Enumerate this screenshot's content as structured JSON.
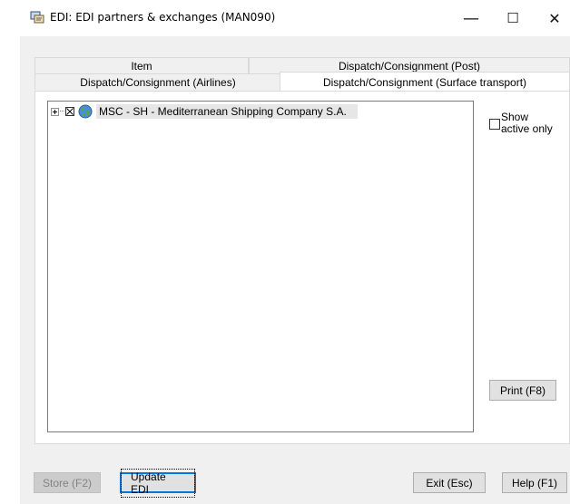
{
  "window": {
    "title": "EDI: EDI partners & exchanges (MAN090)",
    "icon": "edi-app-icon",
    "controls": {
      "minimize": "—",
      "maximize": "☐",
      "close": "✕"
    }
  },
  "tabs": {
    "row1": [
      {
        "label": "Item"
      },
      {
        "label": "Dispatch/Consignment (Post)"
      }
    ],
    "row2": [
      {
        "label": "Dispatch/Consignment (Airlines)"
      },
      {
        "label": "Dispatch/Consignment (Surface transport)"
      }
    ]
  },
  "tree": {
    "nodes": [
      {
        "label": "MSC - SH - Mediterranean Shipping Company S.A.",
        "icon": "globe-icon",
        "checked": true,
        "expanded": false
      }
    ]
  },
  "show_active": {
    "label": "Show active only",
    "checked": false
  },
  "buttons": {
    "print": "Print (F8)",
    "store": "Store (F2)",
    "update": "Update EDI",
    "exit": "Exit (Esc)",
    "help": "Help (F1)"
  }
}
